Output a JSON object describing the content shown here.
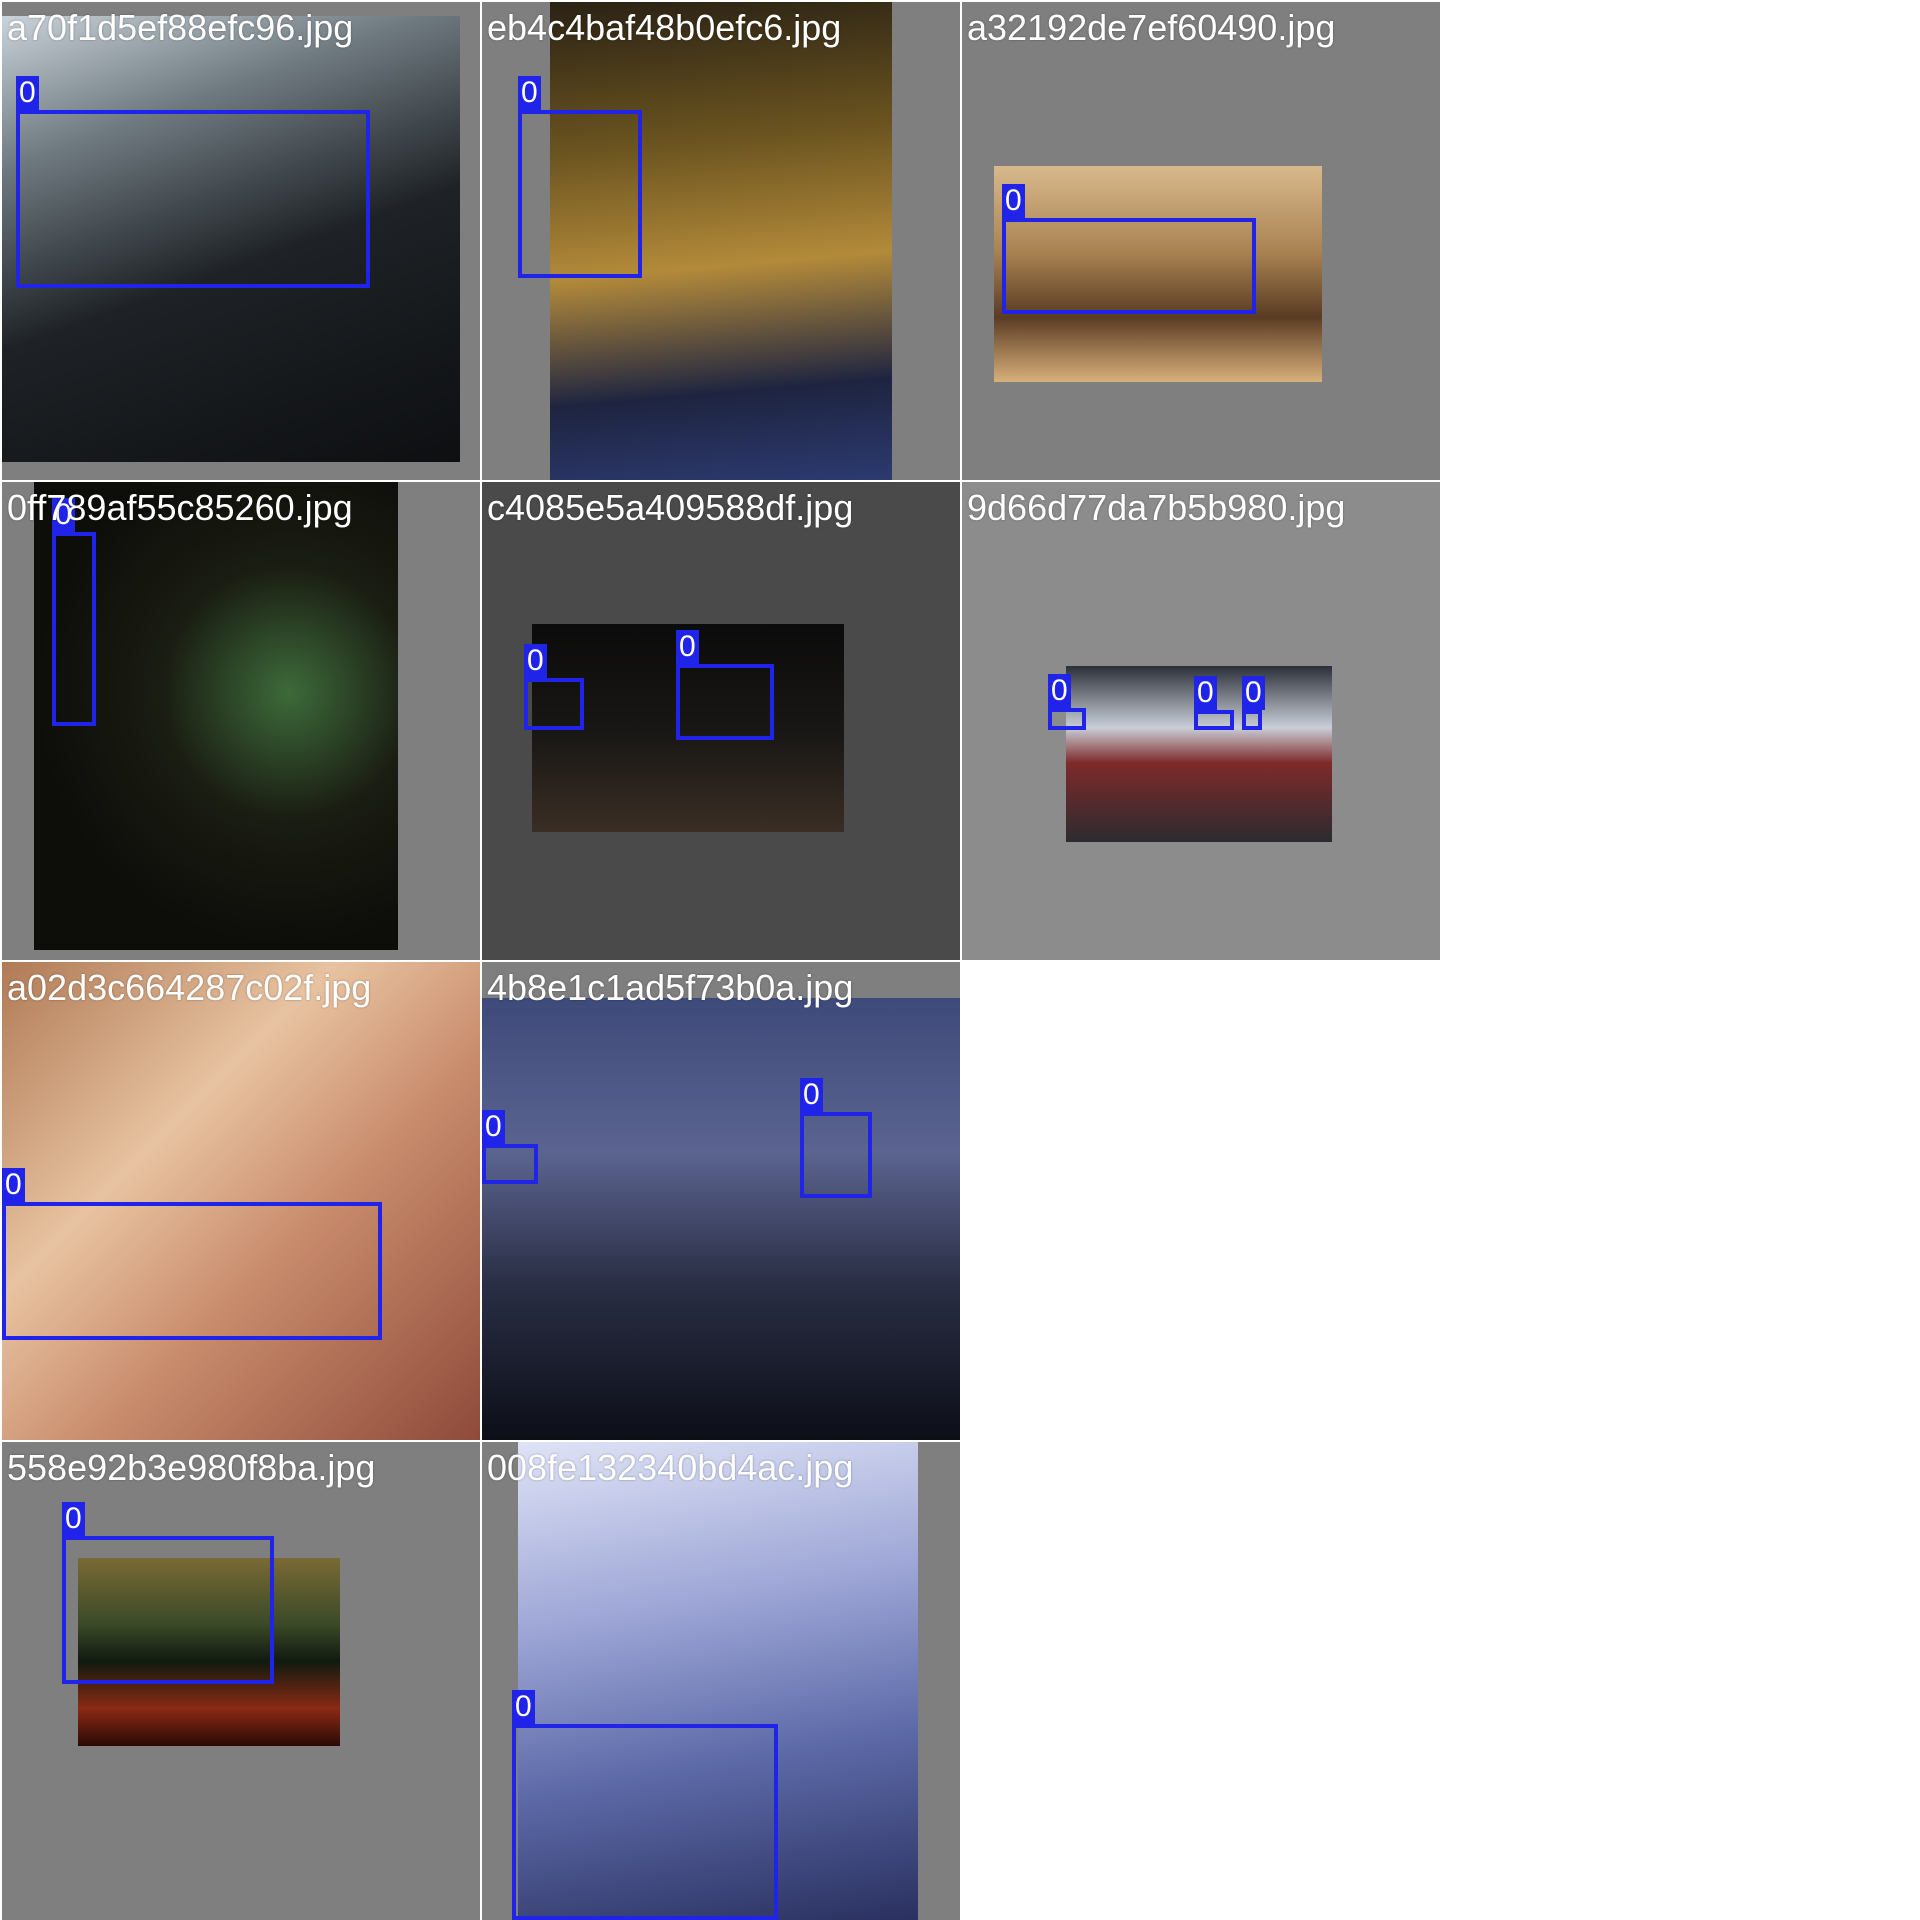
{
  "colors": {
    "box": "#1f24e8",
    "label_text": "#ffffff",
    "page_background": "#ffffff"
  },
  "tiles": [
    {
      "filename": "a70f1d5ef88efc96.jpg",
      "detections": [
        {
          "class_label": "0"
        }
      ]
    },
    {
      "filename": "eb4c4baf48b0efc6.jpg",
      "detections": [
        {
          "class_label": "0"
        }
      ]
    },
    {
      "filename": "a32192de7ef60490.jpg",
      "detections": [
        {
          "class_label": "0"
        }
      ]
    },
    {
      "filename": "0ff789af55c85260.jpg",
      "detections": [
        {
          "class_label": "0"
        }
      ]
    },
    {
      "filename": "c4085e5a409588df.jpg",
      "detections": [
        {
          "class_label": "0"
        },
        {
          "class_label": "0"
        }
      ]
    },
    {
      "filename": "9d66d77da7b5b980.jpg",
      "detections": [
        {
          "class_label": "0"
        },
        {
          "class_label": "0"
        },
        {
          "class_label": "0"
        }
      ]
    },
    {
      "filename": "a02d3c664287c02f.jpg",
      "detections": [
        {
          "class_label": "0"
        }
      ]
    },
    {
      "filename": "4b8e1c1ad5f73b0a.jpg",
      "detections": [
        {
          "class_label": "0"
        },
        {
          "class_label": "0"
        }
      ]
    },
    {
      "filename": "558e92b3e980f8ba.jpg",
      "detections": [
        {
          "class_label": "0"
        }
      ]
    },
    {
      "filename": "008fe132340bd4ac.jpg",
      "detections": [
        {
          "class_label": "0"
        }
      ]
    }
  ]
}
